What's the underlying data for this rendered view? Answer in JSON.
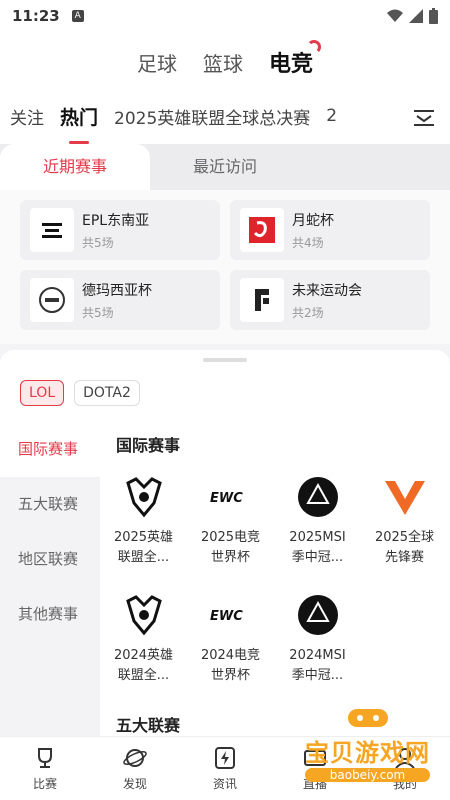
{
  "status": {
    "time": "11:23",
    "notif": "A"
  },
  "header": {
    "sports": [
      "足球",
      "篮球",
      "电竞"
    ]
  },
  "subtabs": [
    "关注",
    "热门",
    "2025英雄联盟全球总决赛",
    "2"
  ],
  "recent": {
    "tabs": [
      "近期赛事",
      "最近访问"
    ],
    "cards": [
      {
        "name": "EPL东南亚",
        "count": "共5场"
      },
      {
        "name": "月蛇杯",
        "count": "共4场"
      },
      {
        "name": "德玛西亚杯",
        "count": "共5场"
      },
      {
        "name": "未来运动会",
        "count": "共2场"
      }
    ]
  },
  "games": [
    "LOL",
    "DOTA2"
  ],
  "leftnav": [
    "国际赛事",
    "五大联赛",
    "地区联赛",
    "其他赛事"
  ],
  "content": {
    "title": "国际赛事",
    "title2": "五大联赛",
    "items": [
      {
        "line1": "2025英雄",
        "line2": "联盟全..."
      },
      {
        "line1": "2025电竞",
        "line2": "世界杯"
      },
      {
        "line1": "2025MSI",
        "line2": "季中冠..."
      },
      {
        "line1": "2025全球",
        "line2": "先锋赛"
      },
      {
        "line1": "2024英雄",
        "line2": "联盟全..."
      },
      {
        "line1": "2024电竞",
        "line2": "世界杯"
      },
      {
        "line1": "2024MSI",
        "line2": "季中冠..."
      }
    ]
  },
  "bottom": [
    "比赛",
    "发现",
    "资讯",
    "直播",
    "我的"
  ],
  "watermark": {
    "big": "宝贝游戏网",
    "small": "baobeiy.com"
  },
  "colors": {
    "accent": "#e53a4a",
    "watermark": "#f6a623"
  }
}
